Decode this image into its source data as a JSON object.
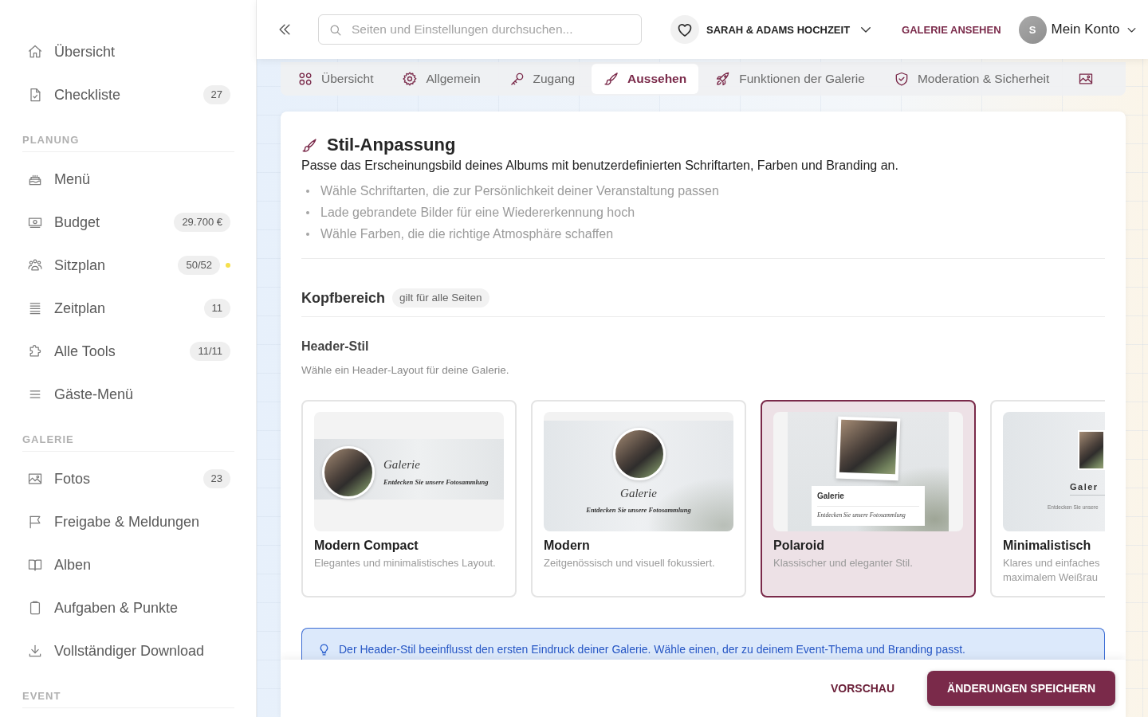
{
  "sidebar": {
    "top_items": [
      {
        "label": "Übersicht",
        "selected": false
      },
      {
        "label": "Checkliste",
        "badge": "27",
        "selected": false
      }
    ],
    "sections": [
      {
        "heading": "PLANUNG",
        "items": [
          {
            "label": "Menü",
            "selected": false
          },
          {
            "label": "Budget",
            "badge": "29.700 €",
            "selected": false
          },
          {
            "label": "Sitzplan",
            "badge": "50/52",
            "color": "#f6e04c",
            "selected": false
          },
          {
            "label": "Zeitplan",
            "badge": "11",
            "selected": false
          },
          {
            "label": "Alle Tools",
            "badge": "11/11",
            "selected": false
          },
          {
            "label": "Gäste-Menü",
            "selected": false
          }
        ]
      },
      {
        "heading": "GALERIE",
        "items": [
          {
            "label": "Fotos",
            "badge": "23",
            "selected": false
          },
          {
            "label": "Freigabe & Meldungen",
            "selected": false
          },
          {
            "label": "Alben",
            "selected": false
          },
          {
            "label": "Aufgaben & Punkte",
            "selected": false
          },
          {
            "label": "Vollständiger Download",
            "selected": false
          }
        ]
      },
      {
        "heading": "EVENT"
      }
    ]
  },
  "top_bar": {
    "search": {
      "placeholder": "Seiten und Einstellungen durchsuchen..."
    },
    "event": "SARAH & ADAMS HOCHZEIT",
    "view_gallery": "GALERIE ANSEHEN",
    "account": {
      "initial": "S",
      "label": "Mein Konto"
    }
  },
  "tabs": [
    {
      "label": "Übersicht",
      "selected": false
    },
    {
      "label": "Allgemein",
      "selected": false
    },
    {
      "label": "Zugang",
      "selected": false
    },
    {
      "label": "Aussehen",
      "selected": true
    },
    {
      "label": "Funktionen der Galerie",
      "selected": false
    },
    {
      "label": "Moderation & Sicherheit",
      "selected": false
    },
    {
      "selected": false
    }
  ],
  "style_section": {
    "title": "Stil-Anpassung",
    "description": "Passe das Erscheinungsbild deines Albums mit benutzerdefinierten Schriftarten, Farben und Branding an.",
    "tips": [
      "Wähle Schriftarten, die zur Persönlichkeit deiner Veranstaltung passen",
      "Lade gebrandete Bilder für eine Wiedererkennung hoch",
      "Wähle Farben, die die richtige Atmosphäre schaffen"
    ]
  },
  "header_area": {
    "title": "Kopfbereich",
    "chip": "gilt für alle Seiten"
  },
  "header_style": {
    "title": "Header-Stil",
    "hint": "Wähle ein Header-Layout für deine Galerie.",
    "options": [
      {
        "kind": "compact",
        "name": "Modern Compact",
        "description": "Elegantes und minimalistisches Layout.",
        "preview_title": "Galerie",
        "preview_subtitle": "Entdecken Sie unsere Fotosammlung",
        "selected": false
      },
      {
        "kind": "modern",
        "name": "Modern",
        "description": "Zeitgenössisch und visuell fokussiert.",
        "preview_title": "Galerie",
        "preview_subtitle": "Entdecken Sie unsere Fotosammlung",
        "selected": false
      },
      {
        "kind": "polaroid",
        "name": "Polaroid",
        "description": "Klassischer und eleganter Stil.",
        "preview_title": "Galerie",
        "preview_subtitle": "Entdecken Sie unsere Fotosammlung",
        "selected": true
      },
      {
        "kind": "minimal",
        "name": "Minimalistisch",
        "description": "Klares und einfaches maximalem Weißrau",
        "preview_title": "Galer",
        "preview_subtitle": "Entdecken Sie unsere",
        "selected": false
      }
    ]
  },
  "notice": {
    "text": "Der Header-Stil beeinflusst den ersten Eindruck deiner Galerie. Wähle einen, der zu deinem Event-Thema und Branding passt."
  },
  "footer": {
    "preview": "VORSCHAU",
    "save": "ÄNDERUNGEN SPEICHERN"
  }
}
